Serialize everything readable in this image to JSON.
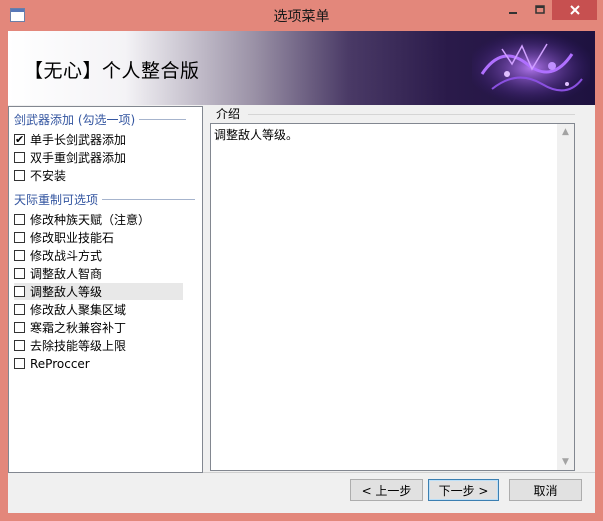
{
  "window": {
    "title": "选项菜单"
  },
  "banner": {
    "title": "【无心】个人整合版"
  },
  "options": {
    "group1": {
      "title": "剑武器添加 (勾选一项)",
      "items": [
        {
          "label": "单手长剑武器添加",
          "checked": true
        },
        {
          "label": "双手重剑武器添加",
          "checked": false
        },
        {
          "label": "不安装",
          "checked": false
        }
      ]
    },
    "group2": {
      "title": "天际重制可选项",
      "items": [
        {
          "label": "修改种族天赋（注意）",
          "checked": false
        },
        {
          "label": "修改职业技能石",
          "checked": false
        },
        {
          "label": "修改战斗方式",
          "checked": false
        },
        {
          "label": "调整敌人智商",
          "checked": false
        },
        {
          "label": "调整敌人等级",
          "checked": false
        },
        {
          "label": "修改敌人聚集区域",
          "checked": false
        },
        {
          "label": "寒霜之秋兼容补丁",
          "checked": false
        },
        {
          "label": "去除技能等级上限",
          "checked": false
        },
        {
          "label": "ReProccer",
          "checked": false
        }
      ]
    }
  },
  "description": {
    "label": "介绍",
    "text": "调整敌人等级。"
  },
  "buttons": {
    "back": "< 上一步",
    "next": "下一步 >",
    "cancel": "取消"
  },
  "icons": {
    "minimize": "minimize-icon",
    "maximize": "maximize-icon",
    "close": "close-icon",
    "scroll_up": "chevron-up-icon",
    "scroll_down": "chevron-down-icon",
    "check": "check-icon"
  }
}
